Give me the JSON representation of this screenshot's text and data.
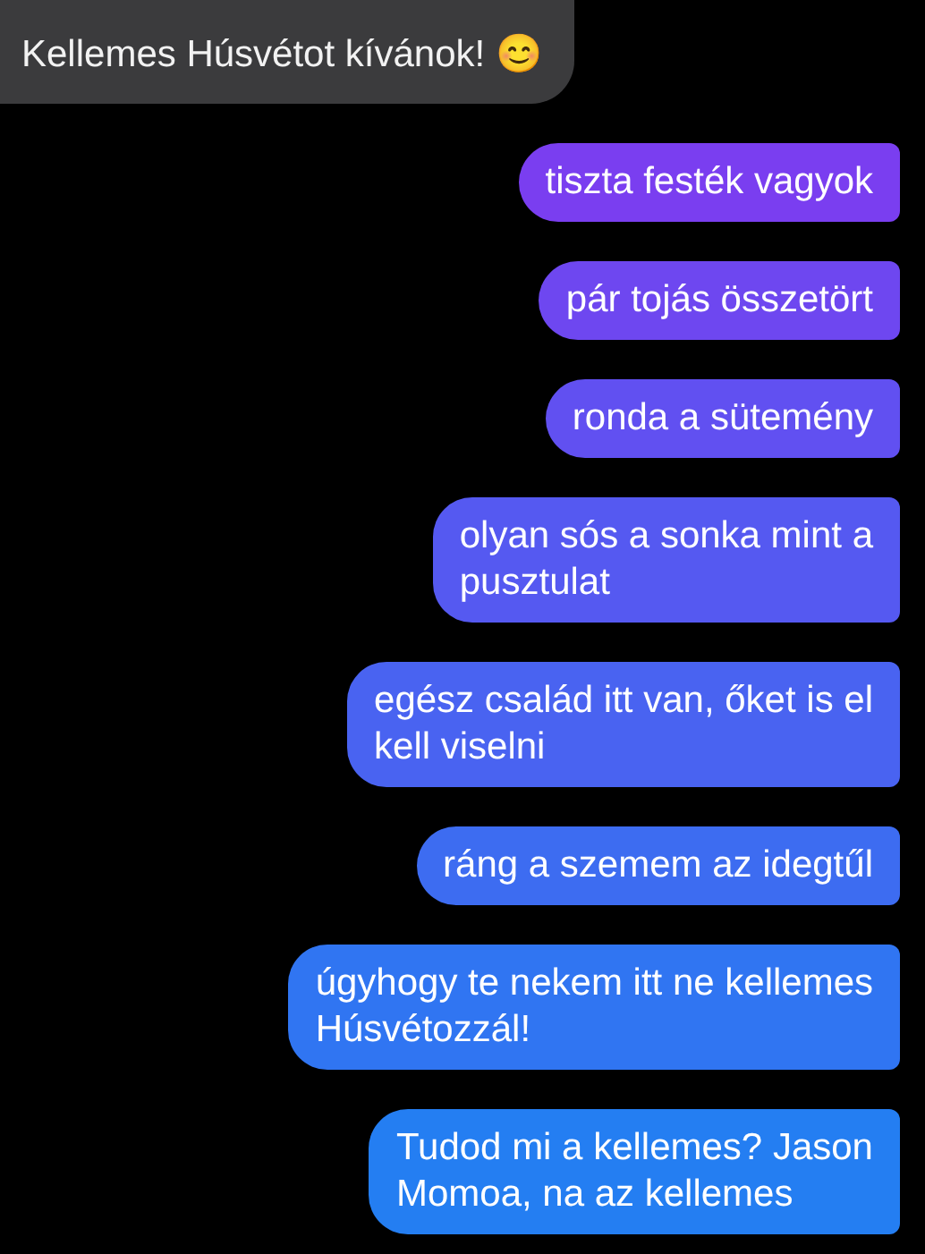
{
  "incoming": [
    {
      "text": "Kellemes Húsvétot kívánok! 😊"
    }
  ],
  "outgoing": [
    {
      "text": "tiszta festék vagyok"
    },
    {
      "text": "pár tojás összetört"
    },
    {
      "text": "ronda a sütemény"
    },
    {
      "text": "olyan sós a sonka mint a\npusztulat"
    },
    {
      "text": "egész család itt van, őket is el\nkell viselni"
    },
    {
      "text": "ráng a szemem az idegtűl"
    },
    {
      "text": "úgyhogy te nekem itt ne kellemes\nHúsvétozzál!"
    },
    {
      "text": "Tudod mi a kellemes? Jason\nMomoa, na az kellemes"
    }
  ]
}
